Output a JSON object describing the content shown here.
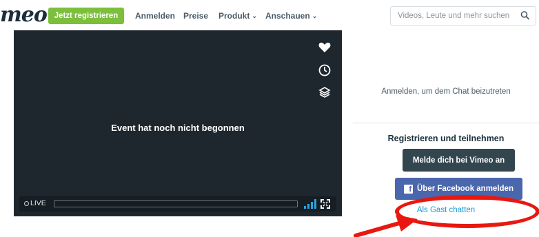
{
  "nav": {
    "logo": "meo",
    "join_label": "Jetzt registrieren",
    "links": [
      {
        "label": "Anmelden"
      },
      {
        "label": "Preise"
      },
      {
        "label": "Produkt",
        "chevron": "⌄"
      },
      {
        "label": "Anschauen",
        "chevron": "⌄"
      }
    ],
    "search_placeholder": "Videos, Leute und mehr suchen"
  },
  "player": {
    "status_text": "Event hat noch nicht begonnen",
    "live_label": "LIVE",
    "side_icons": [
      "heart-icon",
      "clock-icon",
      "layers-icon"
    ],
    "progress_fraction": 0
  },
  "chat": {
    "join_prompt": "Anmelden, um dem Chat beizutreten",
    "register_title": "Registrieren und teilnehmen",
    "vimeo_login": "Melde dich bei Vimeo an",
    "facebook_login": "Über Facebook anmelden",
    "guest_link": "Als Gast chatten"
  },
  "colors": {
    "brand_green": "#7cbf3b",
    "player_bg": "#1f272e",
    "vimeo_button": "#33464f",
    "facebook_button": "#4a66ad",
    "link_blue": "#1a9bd7",
    "annotation_red": "#e81810"
  }
}
